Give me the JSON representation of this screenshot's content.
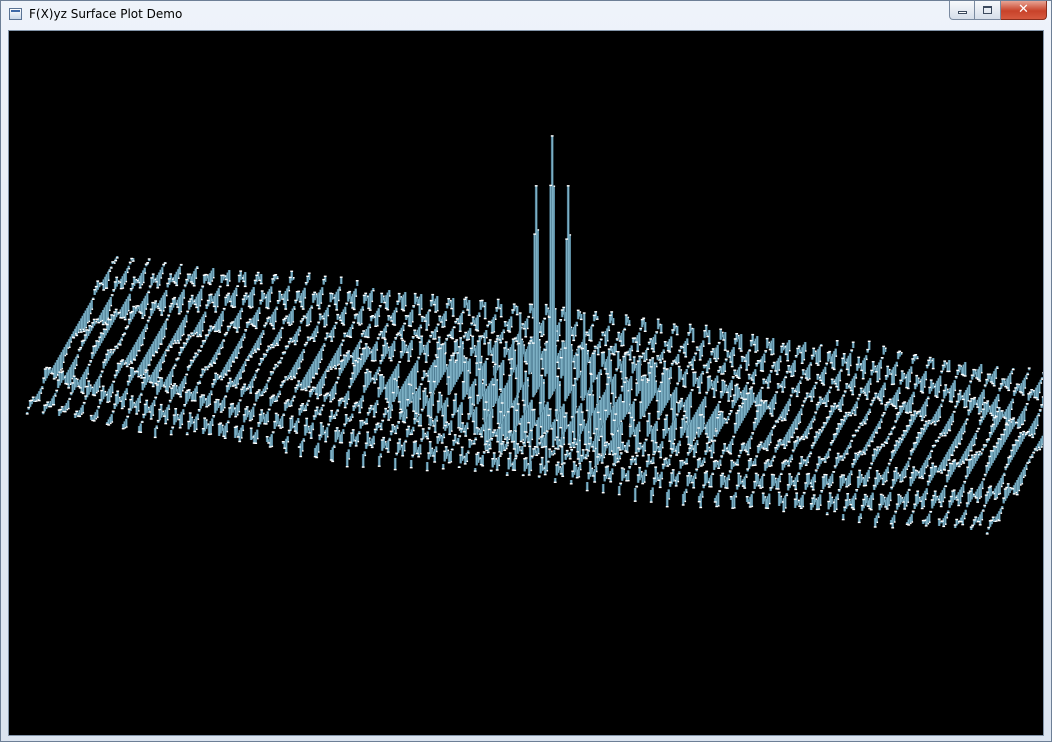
{
  "window": {
    "title": "F(X)yz Surface Plot Demo",
    "icon": "app-window-icon",
    "controls": {
      "minimize_icon": "minimize-icon",
      "maximize_icon": "maximize-icon",
      "close_icon": "close-icon",
      "close_glyph": "✕"
    }
  },
  "scene": {
    "background_color": "#000000",
    "bar_color": "#4f7f94",
    "bar_highlight_color": "#8fc4d8",
    "cap_color": "#ffffff",
    "description_type": "3d-bar-surface"
  }
}
